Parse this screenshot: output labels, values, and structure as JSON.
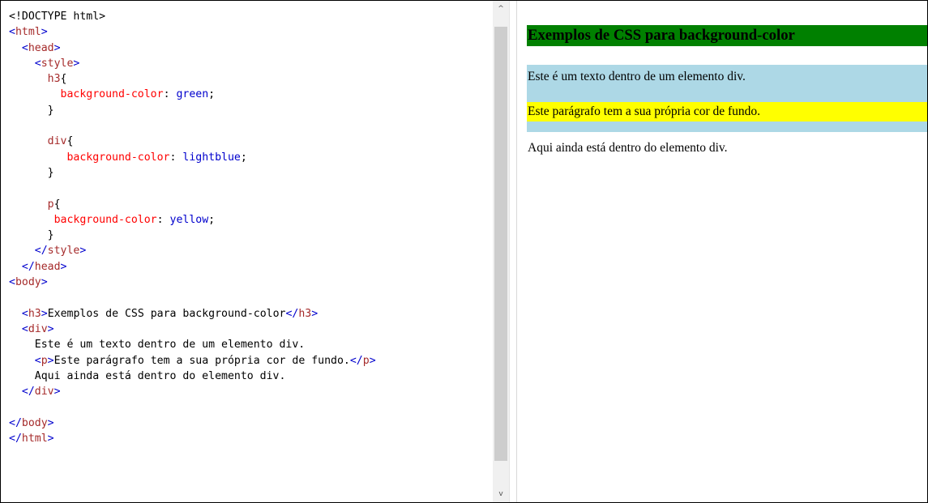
{
  "editor": {
    "lines": [
      [
        {
          "t": "<!DOCTYPE html>",
          "c": "doctype"
        }
      ],
      [
        {
          "t": "<",
          "c": "br"
        },
        {
          "t": "html",
          "c": "tag"
        },
        {
          "t": ">",
          "c": "br"
        }
      ],
      [
        {
          "t": "  "
        },
        {
          "t": "<",
          "c": "br"
        },
        {
          "t": "head",
          "c": "tag"
        },
        {
          "t": ">",
          "c": "br"
        }
      ],
      [
        {
          "t": "    "
        },
        {
          "t": "<",
          "c": "br"
        },
        {
          "t": "style",
          "c": "tag"
        },
        {
          "t": ">",
          "c": "br"
        }
      ],
      [
        {
          "t": "      "
        },
        {
          "t": "h3",
          "c": "sel"
        },
        {
          "t": "{",
          "c": "txt"
        }
      ],
      [
        {
          "t": "        "
        },
        {
          "t": "background-color",
          "c": "prop"
        },
        {
          "t": ": ",
          "c": "txt"
        },
        {
          "t": "green",
          "c": "val"
        },
        {
          "t": ";",
          "c": "txt"
        }
      ],
      [
        {
          "t": "      }",
          "c": "txt"
        }
      ],
      [
        {
          "t": ""
        }
      ],
      [
        {
          "t": "      "
        },
        {
          "t": "div",
          "c": "sel"
        },
        {
          "t": "{",
          "c": "txt"
        }
      ],
      [
        {
          "t": "         "
        },
        {
          "t": "background-color",
          "c": "prop"
        },
        {
          "t": ": ",
          "c": "txt"
        },
        {
          "t": "lightblue",
          "c": "val"
        },
        {
          "t": ";",
          "c": "txt"
        }
      ],
      [
        {
          "t": "      }",
          "c": "txt"
        }
      ],
      [
        {
          "t": ""
        }
      ],
      [
        {
          "t": "      "
        },
        {
          "t": "p",
          "c": "sel"
        },
        {
          "t": "{",
          "c": "txt"
        }
      ],
      [
        {
          "t": "       "
        },
        {
          "t": "background-color",
          "c": "prop"
        },
        {
          "t": ": ",
          "c": "txt"
        },
        {
          "t": "yellow",
          "c": "val"
        },
        {
          "t": ";",
          "c": "txt"
        }
      ],
      [
        {
          "t": "      }",
          "c": "txt"
        }
      ],
      [
        {
          "t": "    "
        },
        {
          "t": "</",
          "c": "br"
        },
        {
          "t": "style",
          "c": "tag"
        },
        {
          "t": ">",
          "c": "br"
        }
      ],
      [
        {
          "t": "  "
        },
        {
          "t": "</",
          "c": "br"
        },
        {
          "t": "head",
          "c": "tag"
        },
        {
          "t": ">",
          "c": "br"
        }
      ],
      [
        {
          "t": "<",
          "c": "br"
        },
        {
          "t": "body",
          "c": "tag"
        },
        {
          "t": ">",
          "c": "br"
        }
      ],
      [
        {
          "t": ""
        }
      ],
      [
        {
          "t": "  "
        },
        {
          "t": "<",
          "c": "br"
        },
        {
          "t": "h3",
          "c": "tag"
        },
        {
          "t": ">",
          "c": "br"
        },
        {
          "t": "Exemplos de CSS para background-color",
          "c": "txt"
        },
        {
          "t": "</",
          "c": "br"
        },
        {
          "t": "h3",
          "c": "tag"
        },
        {
          "t": ">",
          "c": "br"
        }
      ],
      [
        {
          "t": "  "
        },
        {
          "t": "<",
          "c": "br"
        },
        {
          "t": "div",
          "c": "tag"
        },
        {
          "t": ">",
          "c": "br"
        }
      ],
      [
        {
          "t": "    Este é um texto dentro de um elemento div.",
          "c": "txt"
        }
      ],
      [
        {
          "t": "    "
        },
        {
          "t": "<",
          "c": "br"
        },
        {
          "t": "p",
          "c": "tag"
        },
        {
          "t": ">",
          "c": "br"
        },
        {
          "t": "Este parágrafo tem a sua própria cor de fundo.",
          "c": "txt"
        },
        {
          "t": "</",
          "c": "br"
        },
        {
          "t": "p",
          "c": "tag"
        },
        {
          "t": ">",
          "c": "br"
        }
      ],
      [
        {
          "t": "    Aqui ainda está dentro do elemento div.",
          "c": "txt"
        }
      ],
      [
        {
          "t": "  "
        },
        {
          "t": "</",
          "c": "br"
        },
        {
          "t": "div",
          "c": "tag"
        },
        {
          "t": ">",
          "c": "br"
        }
      ],
      [
        {
          "t": ""
        }
      ],
      [
        {
          "t": "</",
          "c": "br"
        },
        {
          "t": "body",
          "c": "tag"
        },
        {
          "t": ">",
          "c": "br"
        }
      ],
      [
        {
          "t": "</",
          "c": "br"
        },
        {
          "t": "html",
          "c": "tag"
        },
        {
          "t": ">",
          "c": "br"
        }
      ]
    ]
  },
  "scrollbar": {
    "up_icon": "chevron-up-icon",
    "down_icon": "chevron-down-icon",
    "up_glyph": "^",
    "down_glyph": "v"
  },
  "preview": {
    "h3": "Exemplos de CSS para background-color",
    "div_line1": "Este é um texto dentro de um elemento div.",
    "p_text": "Este parágrafo tem a sua própria cor de fundo.",
    "div_line2": "Aqui ainda está dentro do elemento div."
  },
  "colors": {
    "h3_background": "#008000",
    "div_background": "#add8e6",
    "p_background": "#ffff00",
    "tag": "#a52a2a",
    "bracket": "#0000cd",
    "property": "#ff0000",
    "value": "#0000cd"
  }
}
